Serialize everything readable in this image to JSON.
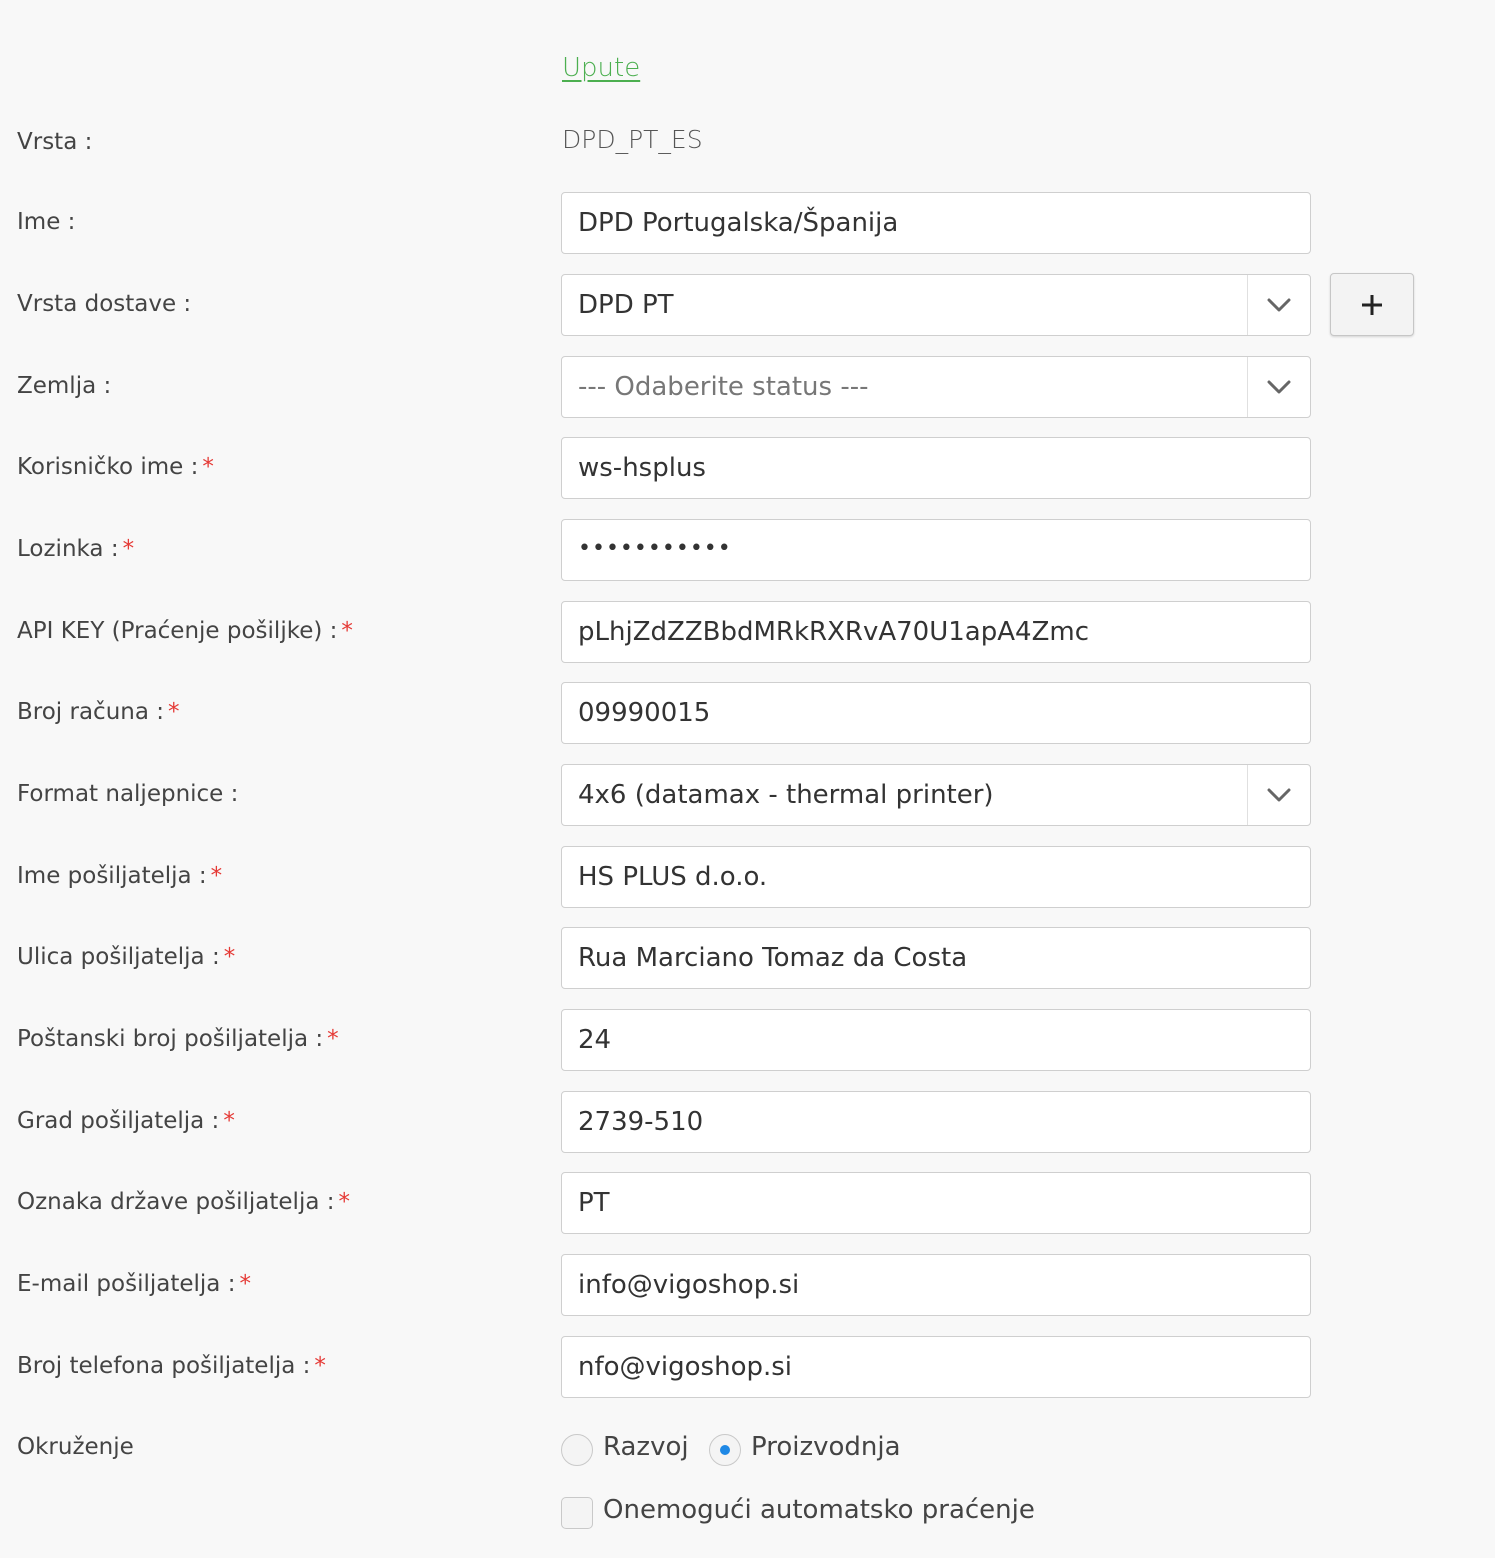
{
  "help_link": "Upute",
  "type_row": {
    "label": "Vrsta :",
    "value": "DPD_PT_ES"
  },
  "name_row": {
    "label": "Ime :",
    "value": "DPD Portugalska/Španija"
  },
  "delivery_type_row": {
    "label": "Vrsta dostave :",
    "value": "DPD PT",
    "add_button": "+"
  },
  "country_row": {
    "label": "Zemlja :",
    "value": "--- Odaberite status ---"
  },
  "username_row": {
    "label": "Korisničko ime :",
    "required": "*",
    "value": "ws-hsplus"
  },
  "password_row": {
    "label": "Lozinka :",
    "required": "*",
    "value": "•••••••••••"
  },
  "api_key_row": {
    "label": "API KEY (Praćenje pošiljke) :",
    "required": "*",
    "value": "pLhjZdZZBbdMRkRXRvA70U1apA4Zmc"
  },
  "account_row": {
    "label": "Broj računa :",
    "required": "*",
    "value": "09990015"
  },
  "label_format_row": {
    "label": "Format naljepnice :",
    "value": "4x6 (datamax - thermal printer)"
  },
  "sender_name_row": {
    "label": "Ime pošiljatelja :",
    "required": "*",
    "value": "HS PLUS d.o.o."
  },
  "sender_street_row": {
    "label": "Ulica pošiljatelja :",
    "required": "*",
    "value": "Rua Marciano Tomaz da Costa"
  },
  "sender_postal_row": {
    "label": "Poštanski broj pošiljatelja :",
    "required": "*",
    "value": "24"
  },
  "sender_city_row": {
    "label": "Grad pošiljatelja :",
    "required": "*",
    "value": "2739-510"
  },
  "sender_country_row": {
    "label": "Oznaka države pošiljatelja :",
    "required": "*",
    "value": "PT"
  },
  "sender_email_row": {
    "label": "E-mail pošiljatelja :",
    "required": "*",
    "value": "info@vigoshop.si"
  },
  "sender_phone_row": {
    "label": "Broj telefona pošiljatelja :",
    "required": "*",
    "value": "nfo@vigoshop.si"
  },
  "environment_row": {
    "label": "Okruženje",
    "options": [
      "Razvoj",
      "Proizvodnja"
    ],
    "selected": "Proizvodnja"
  },
  "disable_tracking": {
    "label": "Onemogući automatsko praćenje",
    "checked": false
  },
  "colors": {
    "link": "#4caf50",
    "required": "#e53935",
    "radio_selected": "#1e88e5",
    "background": "#f8f8f8"
  },
  "icons": {
    "select_arrow": "chevron-down-icon",
    "add": "plus-icon"
  }
}
